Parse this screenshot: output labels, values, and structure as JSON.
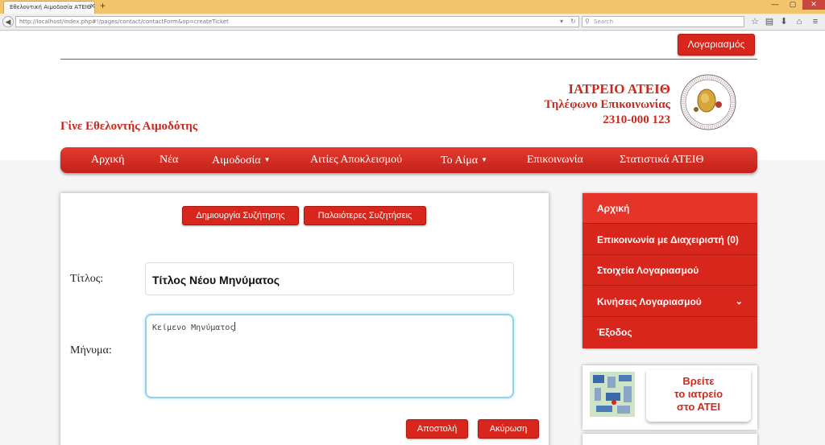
{
  "browser": {
    "tab_title": "Εθελοντική Αιμοδοσία ΑΤΕΙΘ",
    "tab_close": "×",
    "new_tab": "+",
    "url_host": "http://localhost",
    "url_path": "/index.php#!/pages/contact/contactForm&op=createTicket",
    "search_placeholder": "Search"
  },
  "header": {
    "account_button": "Λογαριασμός",
    "site_title": "Γίνε Εθελοντής Αιμοδότης",
    "clinic_name": "ΙΑΤΡΕΙΟ ΑΤΕΙΘ",
    "clinic_phone_label": "Τηλέφωνο Επικοινωνίας",
    "clinic_phone": "2310-000 123"
  },
  "menu": {
    "items": [
      {
        "label": "Αρχική"
      },
      {
        "label": "Νέα"
      },
      {
        "label": "Αιμοδοσία",
        "caret": "▼"
      },
      {
        "label": "Αιτίες Αποκλεισμού"
      },
      {
        "label": "Το Αίμα",
        "caret": "▼"
      },
      {
        "label": "Επικοινωνία"
      },
      {
        "label": "Στατιστικά ΑΤΕΙΘ"
      }
    ]
  },
  "form": {
    "new_discussion_button": "Δημιουργία Συζήτησης",
    "old_discussions_button": "Παλαιότερες Συζητήσεις",
    "title_label": "Τίτλος:",
    "title_value": "Τίτλος Νέου Μηνύματος",
    "message_label": "Μήνυμα:",
    "message_value": "Κείμενο Μηνύματος",
    "send_button": "Αποστολή",
    "cancel_button": "Ακύρωση"
  },
  "sidebar": {
    "items": [
      {
        "label": "Αρχική"
      },
      {
        "label": "Επικοινωνία με Διαχειριστή (0)"
      },
      {
        "label": "Στοιχεία Λογαριασμού"
      },
      {
        "label": "Κινήσεις Λογαριασμού",
        "chevron": "⌄"
      },
      {
        "label": "Έξοδος"
      }
    ],
    "promo_line1": "Βρείτε",
    "promo_line2": "το ιατρείο",
    "promo_line3": "στο ΑΤΕΙ"
  },
  "colors": {
    "accent_red": "#d9261c",
    "title_red": "#c8281d",
    "input_focus": "#8ed3e8"
  }
}
